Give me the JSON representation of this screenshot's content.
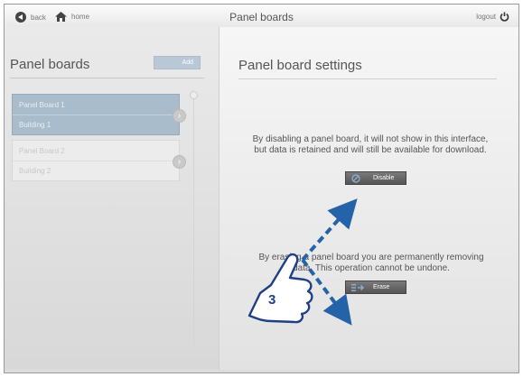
{
  "topbar": {
    "back_label": "back",
    "home_label": "home",
    "title": "Panel boards",
    "logout_label": "logout"
  },
  "left": {
    "title": "Panel boards",
    "add_label": "Add",
    "items": [
      {
        "name": "Panel Board 1",
        "building": "Building 1",
        "selected": true
      },
      {
        "name": "Panel Board 2",
        "building": "Building 2",
        "selected": false
      }
    ]
  },
  "right": {
    "title": "Panel board settings",
    "disable_text": "By disabling a panel board, it will not show in this interface, but data is retained and will still be available for download.",
    "disable_label": "Disable",
    "erase_text": "By erasing a panel board you are permanently removing data. This operation cannot be undone.",
    "erase_label": "Erase"
  },
  "callout": {
    "step_number": "3",
    "arrow_color": "#2463a8"
  },
  "icons": {
    "back": "back-arrow-icon",
    "home": "home-icon",
    "logout": "power-icon",
    "disable": "prohibit-icon",
    "erase": "erase-list-icon",
    "chevron": "chevron-right-icon"
  }
}
